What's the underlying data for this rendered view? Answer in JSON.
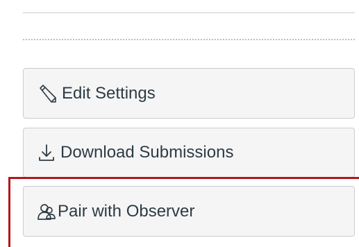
{
  "actions": {
    "edit_settings_label": "Edit Settings",
    "download_submissions_label": "Download Submissions",
    "pair_with_observer_label": "Pair with Observer"
  },
  "icons": {
    "edit": "pencil-icon",
    "download": "download-icon",
    "pair": "pair-observer-icon"
  },
  "colors": {
    "highlight": "#b3161c",
    "button_bg": "#f5f5f5",
    "button_border": "#c7cdd1",
    "text": "#2d3b45"
  }
}
